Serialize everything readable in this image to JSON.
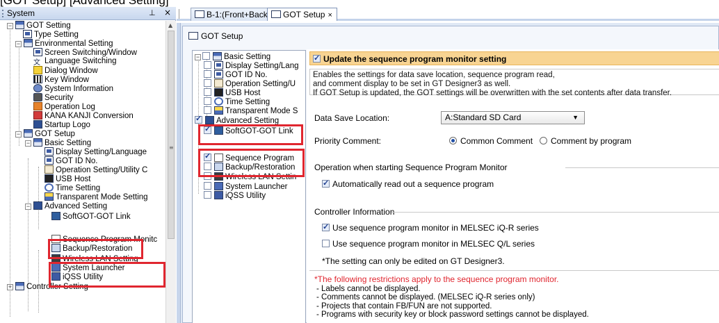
{
  "caption": "[GOT Setup] [Advanced Setting]",
  "system_panel": {
    "title": "System",
    "pin_glyph": "⊥",
    "close_glyph": "×",
    "tree": [
      {
        "label": "GOT Setting",
        "icon": "got-icon"
      },
      {
        "label": "Type Setting",
        "icon": "type-icon"
      },
      {
        "label": "Environmental Setting",
        "icon": "env-icon"
      },
      {
        "label": "Screen Switching/Window",
        "icon": "screen-icon"
      },
      {
        "label": "Language Switching",
        "icon": "language-icon"
      },
      {
        "label": "Dialog Window",
        "icon": "warning-icon"
      },
      {
        "label": "Key Window",
        "icon": "key-window-icon"
      },
      {
        "label": "System Information",
        "icon": "info-icon"
      },
      {
        "label": "Security",
        "icon": "security-icon"
      },
      {
        "label": "Operation Log",
        "icon": "log-icon"
      },
      {
        "label": "KANA KANJI Conversion",
        "icon": "kana-icon"
      },
      {
        "label": "Startup Logo",
        "icon": "logo-icon"
      },
      {
        "label": "GOT Setup",
        "icon": "got-setup-icon"
      },
      {
        "label": "Basic Setting",
        "icon": "basic-icon"
      },
      {
        "label": "Display Setting/Language",
        "icon": "display-icon"
      },
      {
        "label": "GOT ID No.",
        "icon": "id-icon"
      },
      {
        "label": "Operation Setting/Utility C",
        "icon": "utility-icon"
      },
      {
        "label": "USB Host",
        "icon": "usb-icon"
      },
      {
        "label": "Time Setting",
        "icon": "clock-icon"
      },
      {
        "label": "Transparent Mode Setting",
        "icon": "transparent-icon"
      },
      {
        "label": "Advanced Setting",
        "icon": "advanced-icon"
      },
      {
        "label": "SoftGOT-GOT Link",
        "icon": "link-icon"
      },
      {
        "label": "Sequence Program Monitc",
        "icon": "sequence-icon"
      },
      {
        "label": "Backup/Restoration",
        "icon": "backup-icon"
      },
      {
        "label": "Wireless LAN Setting",
        "icon": "wireless-icon"
      },
      {
        "label": "System Launcher",
        "icon": "launcher-icon"
      },
      {
        "label": "iQSS Utility",
        "icon": "iqss-icon"
      },
      {
        "label": "Controller Setting",
        "icon": "controller-icon"
      }
    ]
  },
  "tabs": [
    {
      "label": "B-1:(Front+Back)",
      "close": "×",
      "active": false
    },
    {
      "label": "GOT Setup",
      "close": "×",
      "active": true
    }
  ],
  "editor": {
    "title": "GOT Setup",
    "mid_tree": [
      {
        "label": "Basic Setting",
        "checked": false
      },
      {
        "label": "Display Setting/Lang",
        "checked": false
      },
      {
        "label": "GOT ID No.",
        "checked": false
      },
      {
        "label": "Operation Setting/U",
        "checked": false
      },
      {
        "label": "USB Host",
        "checked": false
      },
      {
        "label": "Time Setting",
        "checked": false
      },
      {
        "label": "Transparent Mode S",
        "checked": false
      },
      {
        "label": "Advanced Setting",
        "checked": true
      },
      {
        "label": "SoftGOT-GOT Link",
        "checked": true
      },
      {
        "label": "Sequence Program",
        "checked": true
      },
      {
        "label": "Backup/Restoration",
        "checked": false
      },
      {
        "label": "Wireless LAN Settin",
        "checked": false
      },
      {
        "label": "System Launcher",
        "checked": false
      },
      {
        "label": "iQSS Utility",
        "checked": false
      }
    ],
    "update_checkbox": {
      "label": "Update the sequence program monitor setting",
      "checked": true
    },
    "description": [
      "Enables the settings for data save location, sequence program read,",
      "and comment display to be set in GT Designer3 as well.",
      "If GOT Setup is updated, the GOT settings will be overwritten with the set contents after data transfer."
    ],
    "data_save_location": {
      "label": "Data Save Location:",
      "value": "A:Standard SD Card"
    },
    "priority_comment": {
      "label": "Priority Comment:",
      "options": [
        "Common Comment",
        "Comment by program"
      ],
      "selected": 0
    },
    "operation_section": {
      "title": "Operation when starting Sequence Program Monitor",
      "auto_read": {
        "label": "Automatically read out a sequence program",
        "checked": true
      }
    },
    "controller_section": {
      "title": "Controller Information",
      "iqr": {
        "label": "Use sequence program monitor in MELSEC iQ-R series",
        "checked": true
      },
      "ql": {
        "label": "Use sequence program monitor in MELSEC Q/L series",
        "checked": false
      },
      "note": "*The setting can only be edited on GT Designer3."
    },
    "restrictions": {
      "title": "*The following restrictions apply to the sequence program monitor.",
      "items": [
        "- Labels cannot be displayed.",
        "- Comments cannot be displayed. (MELSEC iQ-R series only)",
        "- Projects that contain FB/FUN are not supported.",
        "- Programs with security key or block password settings cannot be displayed."
      ]
    }
  },
  "colors": {
    "highlight_box": "#e0262f",
    "update_bar": "#f8d492",
    "accent": "#1f4ea5"
  }
}
